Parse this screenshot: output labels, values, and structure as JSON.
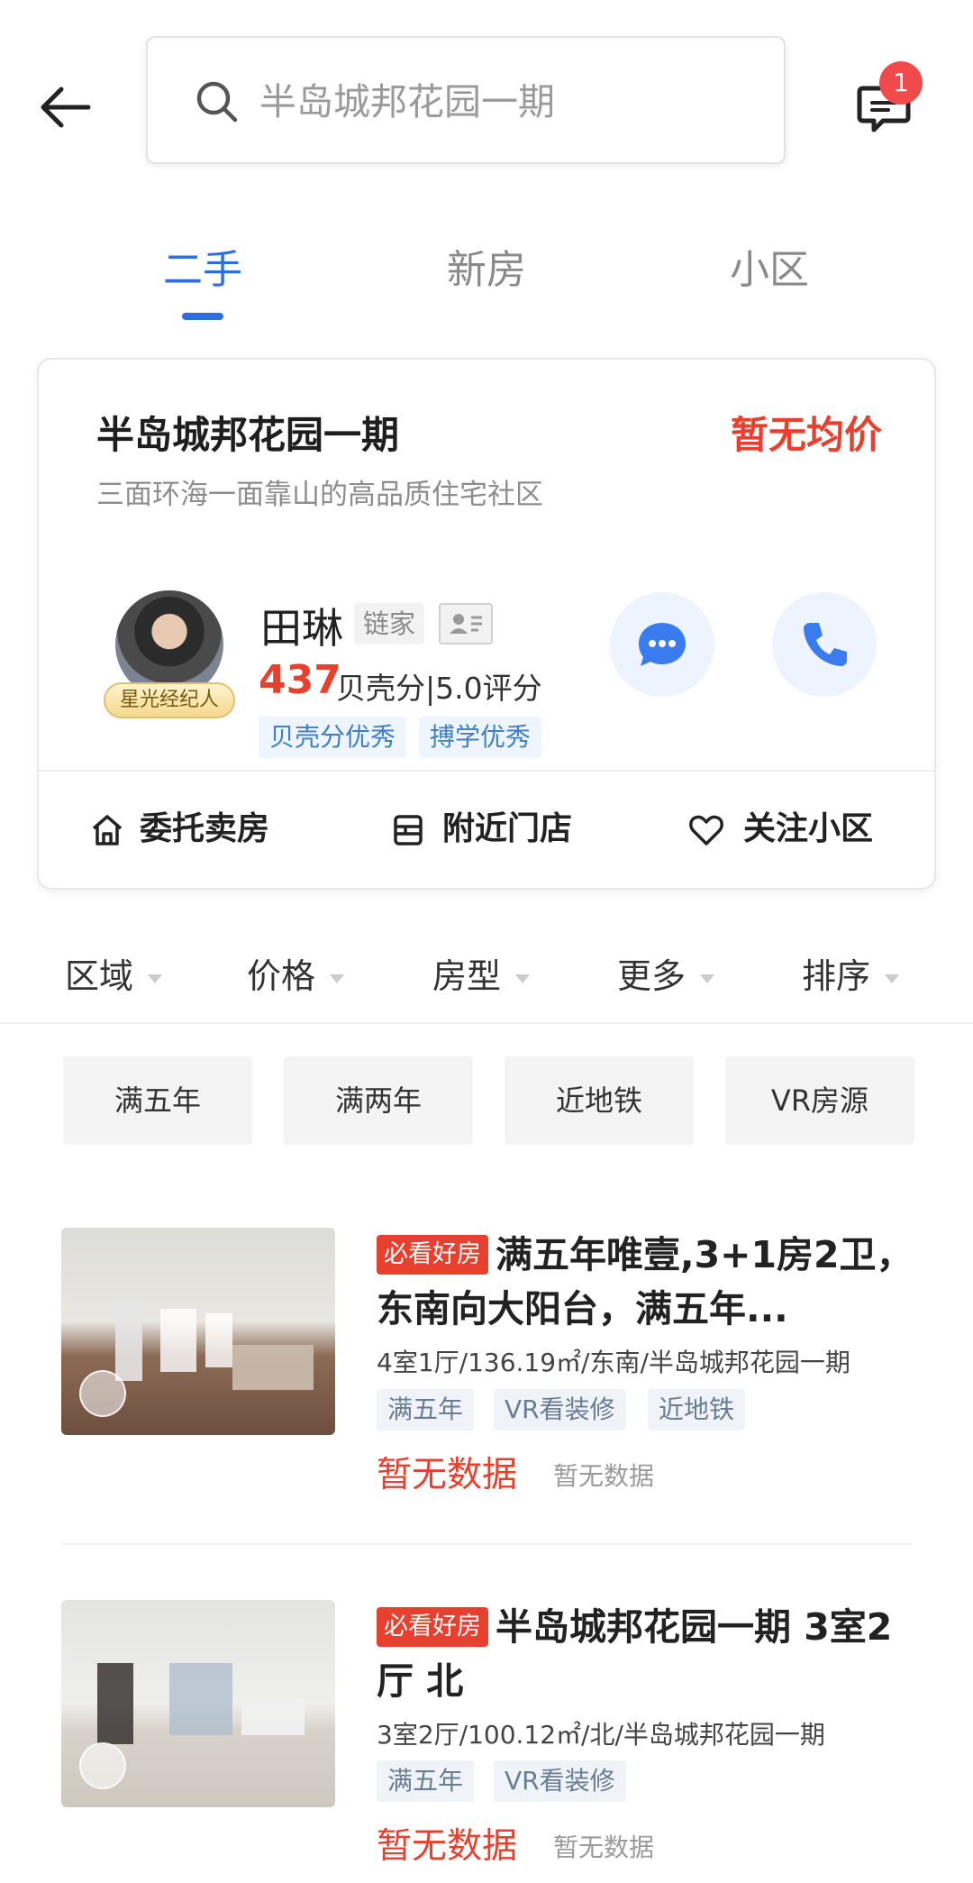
{
  "header": {
    "search_text": "半岛城邦花园一期",
    "message_badge": "1"
  },
  "tabs": [
    {
      "label": "二手",
      "active": true
    },
    {
      "label": "新房",
      "active": false
    },
    {
      "label": "小区",
      "active": false
    }
  ],
  "community": {
    "name": "半岛城邦花园一期",
    "avg_price": "暂无均价",
    "subtitle": "三面环海一面靠山的高品质住宅社区",
    "agent": {
      "name": "田琳",
      "company": "链家",
      "tag": "星光经纪人",
      "score": "437",
      "score_text": "贝壳分|5.0评分",
      "badges": [
        "贝壳分优秀",
        "搏学优秀"
      ]
    },
    "actions": [
      {
        "label": "委托卖房",
        "icon": "home-icon"
      },
      {
        "label": "附近门店",
        "icon": "store-icon"
      },
      {
        "label": "关注小区",
        "icon": "heart-icon"
      }
    ]
  },
  "filters": [
    "区域",
    "价格",
    "房型",
    "更多",
    "排序"
  ],
  "quick_tags": [
    "满五年",
    "满两年",
    "近地铁",
    "VR房源"
  ],
  "listings": [
    {
      "badge": "必看好房",
      "title": "满五年唯壹,3+1房2卫，东南向大阳台，满五年...",
      "meta": "4室1厅/136.19㎡/东南/半岛城邦花园一期",
      "tags": [
        "满五年",
        "VR看装修",
        "近地铁"
      ],
      "price": "暂无数据",
      "unit_price": "暂无数据"
    },
    {
      "badge": "必看好房",
      "title": "半岛城邦花园一期 3室2厅 北",
      "meta": "3室2厅/100.12㎡/北/半岛城邦花园一期",
      "tags": [
        "满五年",
        "VR看装修"
      ],
      "price": "暂无数据",
      "unit_price": "暂无数据"
    }
  ],
  "colors": {
    "accent_blue": "#2f6ee0",
    "price_red": "#e8402e"
  }
}
